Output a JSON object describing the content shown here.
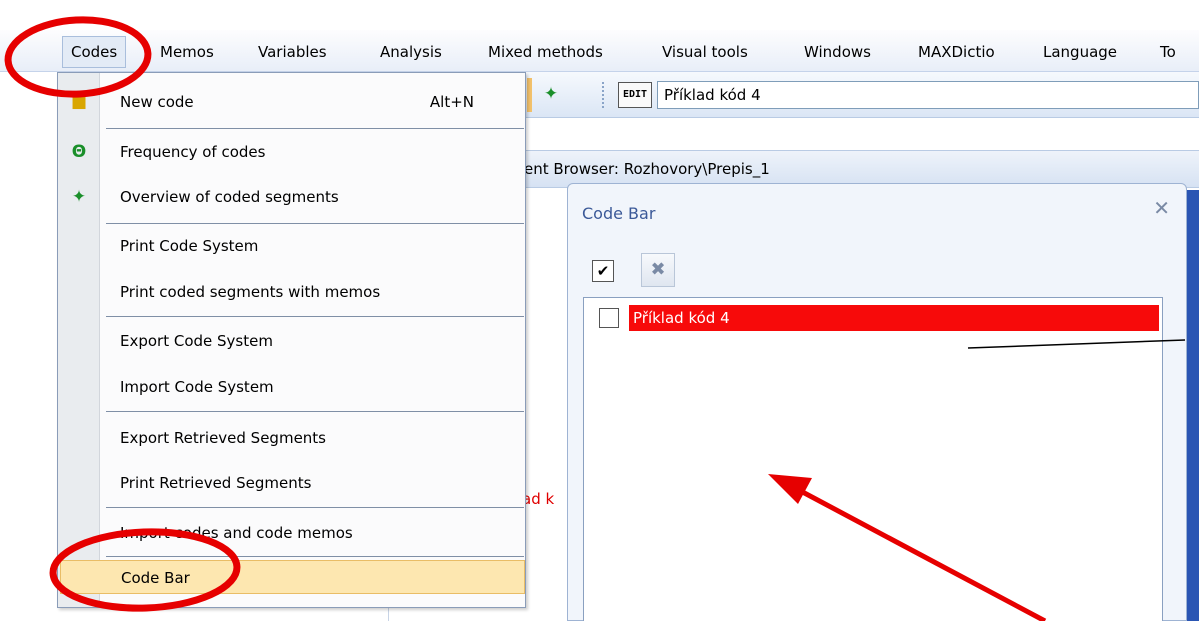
{
  "menubar": {
    "items": [
      "Codes",
      "Memos",
      "Variables",
      "Analysis",
      "Mixed methods",
      "Visual tools",
      "Windows",
      "MAXDictio",
      "Language",
      "To"
    ]
  },
  "toolbar": {
    "edit_icon": "EDIT",
    "code_field_value": "Příklad kód 4",
    "codes_icon": "codes-icon"
  },
  "doc_browser": {
    "title": "ent Browser: Rozhovory\\Prepis_1"
  },
  "background": {
    "red_fragment": "ad k"
  },
  "codes_menu": {
    "items": [
      {
        "label": "New code",
        "shortcut": "Alt+N",
        "icon": "new-code-icon"
      },
      {
        "label": "Frequency of codes",
        "icon": "frequency-icon"
      },
      {
        "label": "Overview of coded segments",
        "icon": "overview-icon"
      },
      {
        "label": "Print Code System"
      },
      {
        "label": "Print coded segments with memos"
      },
      {
        "label": "Export Code System"
      },
      {
        "label": "Import Code System"
      },
      {
        "label": "Export Retrieved Segments"
      },
      {
        "label": "Print Retrieved Segments"
      },
      {
        "label": "Import codes and code memos"
      },
      {
        "label": "Code Bar"
      }
    ]
  },
  "code_bar": {
    "title": "Code Bar",
    "rows": [
      {
        "label": "Příklad kód 4",
        "checked": false,
        "color": "#f70a0a"
      }
    ]
  },
  "annotation_color": "#e60000"
}
